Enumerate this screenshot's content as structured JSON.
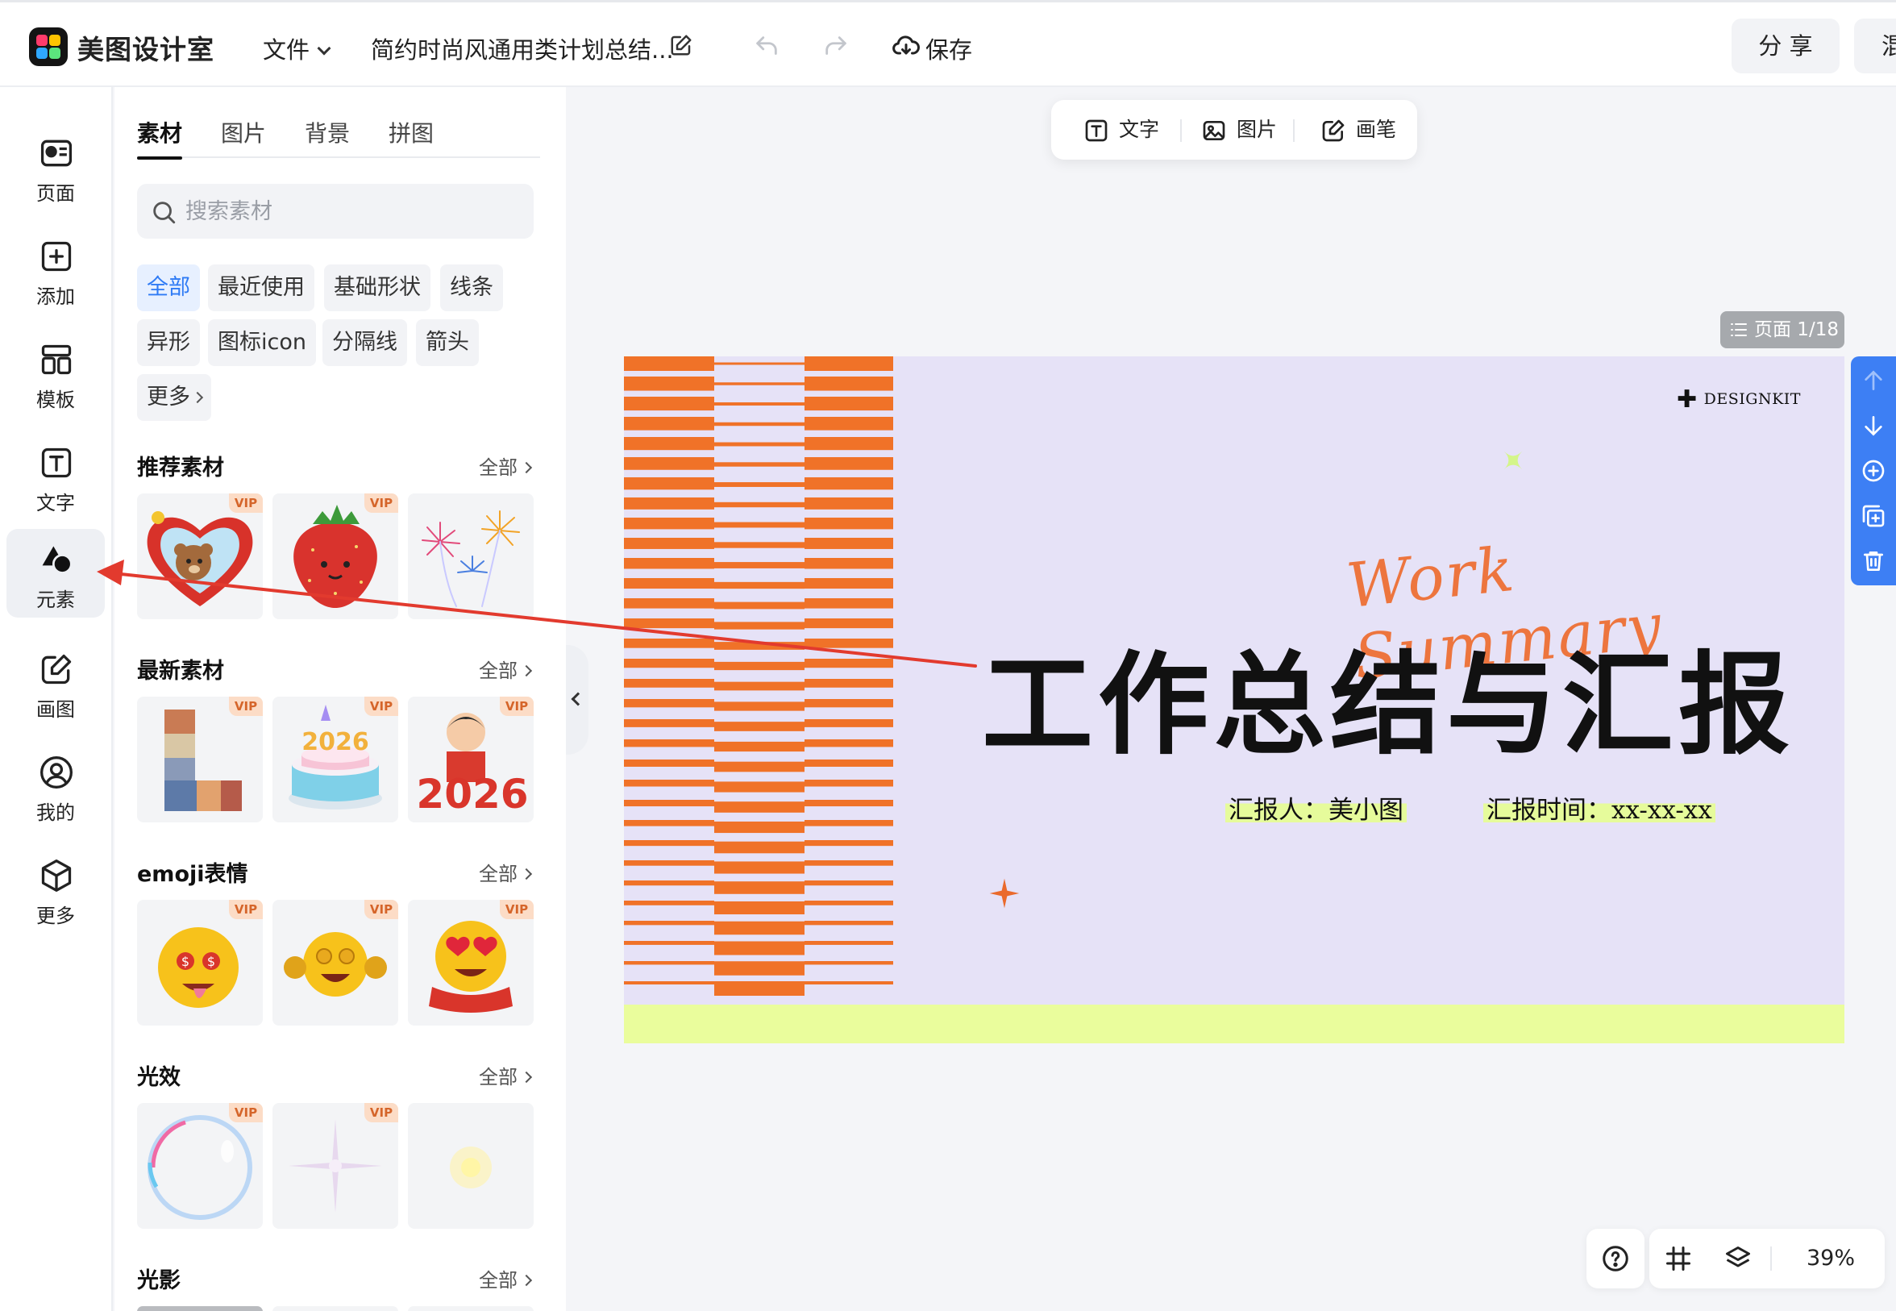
{
  "app": {
    "brand": "美图设计室",
    "menu_file": "文件",
    "doc_title": "简约时尚风通用类计划总结...",
    "save_label": "保存",
    "share_label": "分 享",
    "extra_label": "混"
  },
  "rail": {
    "items": [
      {
        "label": "页面",
        "icon": "page-icon"
      },
      {
        "label": "添加",
        "icon": "add-icon"
      },
      {
        "label": "模板",
        "icon": "template-icon"
      },
      {
        "label": "文字",
        "icon": "text-icon"
      },
      {
        "label": "元素",
        "icon": "shapes-icon"
      },
      {
        "label": "画图",
        "icon": "draw-icon"
      },
      {
        "label": "我的",
        "icon": "user-icon"
      },
      {
        "label": "更多",
        "icon": "cube-icon"
      }
    ],
    "active_index": 4
  },
  "panel": {
    "tabs": [
      "素材",
      "图片",
      "背景",
      "拼图"
    ],
    "active_tab": 0,
    "search_placeholder": "搜索素材",
    "chips": [
      "全部",
      "最近使用",
      "基础形状",
      "线条",
      "异形",
      "图标icon",
      "分隔线",
      "箭头",
      "更多"
    ],
    "active_chip": 0,
    "all_label": "全部",
    "vip_label": "VIP",
    "sections": [
      {
        "title": "推荐素材"
      },
      {
        "title": "最新素材"
      },
      {
        "title": "emoji表情"
      },
      {
        "title": "光效"
      },
      {
        "title": "光影"
      }
    ]
  },
  "canvas_toolbar": {
    "text_label": "文字",
    "image_label": "图片",
    "brush_label": "画笔"
  },
  "page_indicator": "页面 1/18",
  "slide": {
    "brand_mark": "DESIGNKIT",
    "script_text": "Work Summary",
    "title": "工作总结与汇报",
    "reporter": "汇报人：美小图",
    "report_time": "汇报时间：xx-xx-xx"
  },
  "zoom": {
    "level": "39%"
  },
  "colors": {
    "accent_blue": "#3d7ff4",
    "slide_bg": "#e6e2f7",
    "slide_orange": "#f07228",
    "slide_lime": "#eafd9c",
    "annotation_red": "#e23a2e"
  }
}
